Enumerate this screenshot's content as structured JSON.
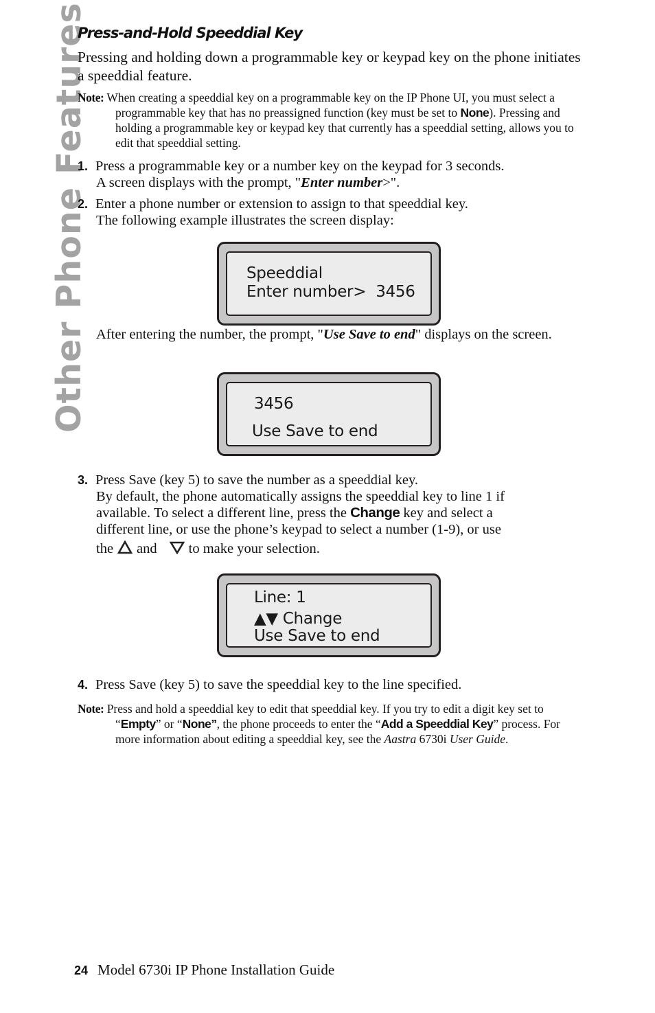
{
  "side_tab": "Other Phone Features",
  "heading": "Press-and-Hold Speeddial Key",
  "intro": "Pressing and holding down a programmable key or keypad key on the phone initiates a speeddial feature.",
  "note1": {
    "label": "Note:",
    "text_a": "When creating a speeddial key on a programmable key on the IP Phone UI, you must select a programmable key that has no preassigned function (key must be set to ",
    "kw": "None",
    "text_b": "). Pressing and holding a programmable key or keypad key that currently has a speeddial setting, allows you to edit that speeddial setting."
  },
  "steps": [
    {
      "num": "1.",
      "line1": "Press a programmable key or a number key on the keypad for 3 seconds.",
      "line2_a": "A screen displays with the prompt, \"",
      "line2_em": "Enter number",
      "line2_b": ">\"."
    },
    {
      "num": "2.",
      "line1": "Enter a phone number or extension to assign to that speeddial key.",
      "line2": "The following example illustrates the screen display:"
    },
    {
      "num": "3.",
      "line1": "Press Save (key 5) to save the number as a speeddial key.",
      "line2": "By default, the phone automatically assigns the speeddial key to line 1 if",
      "line3_a": "available. To select a different line, press the ",
      "line3_kw": "Change",
      "line3_b": " key and select a",
      "line4": "different line, or use the phone’s keypad to select a number (1-9), or use",
      "line5_a": "the",
      "line5_mid": "and",
      "line5_b": "to make your selection."
    },
    {
      "num": "4.",
      "line1": "Press  Save (key 5) to save the speeddial key to the line specified."
    }
  ],
  "after_entering": {
    "text_a": "After entering the number, the prompt, \"",
    "em": "Use Save to end",
    "text_b": "\" displays on the screen."
  },
  "lcd_screens": [
    {
      "lines": [
        "Speeddial",
        "Enter number>  3456"
      ]
    },
    {
      "lines": [
        "3456",
        "Use Save to end"
      ]
    },
    {
      "lines": [
        "Line: 1",
        "Change",
        "Use Save to end"
      ],
      "icons": [
        "up-arrow-icon",
        "down-arrow-icon"
      ]
    }
  ],
  "note2": {
    "label": "Note:",
    "t1": "Press and hold a speeddial key to edit that speeddial key. If you try to edit a digit key set to “",
    "kw1": "Empty",
    "t2": "” or “",
    "kw2": "None”",
    "t3": ", the phone proceeds to enter the “",
    "kw3": "Add a Speeddial Key",
    "t4": "” process. For more information about editing a speeddial key, see the ",
    "em1": "Aastra",
    "t5": " 6730i ",
    "em2": "User Guide",
    "t6": "."
  },
  "footer": {
    "page_number": "24",
    "title": "Model 6730i IP Phone Installation Guide"
  },
  "colors": {
    "side_tab": "#a3a3a3",
    "lcd_frame": "#c6c6c6",
    "lcd_screen": "#ececec",
    "lcd_border": "#231f20"
  }
}
